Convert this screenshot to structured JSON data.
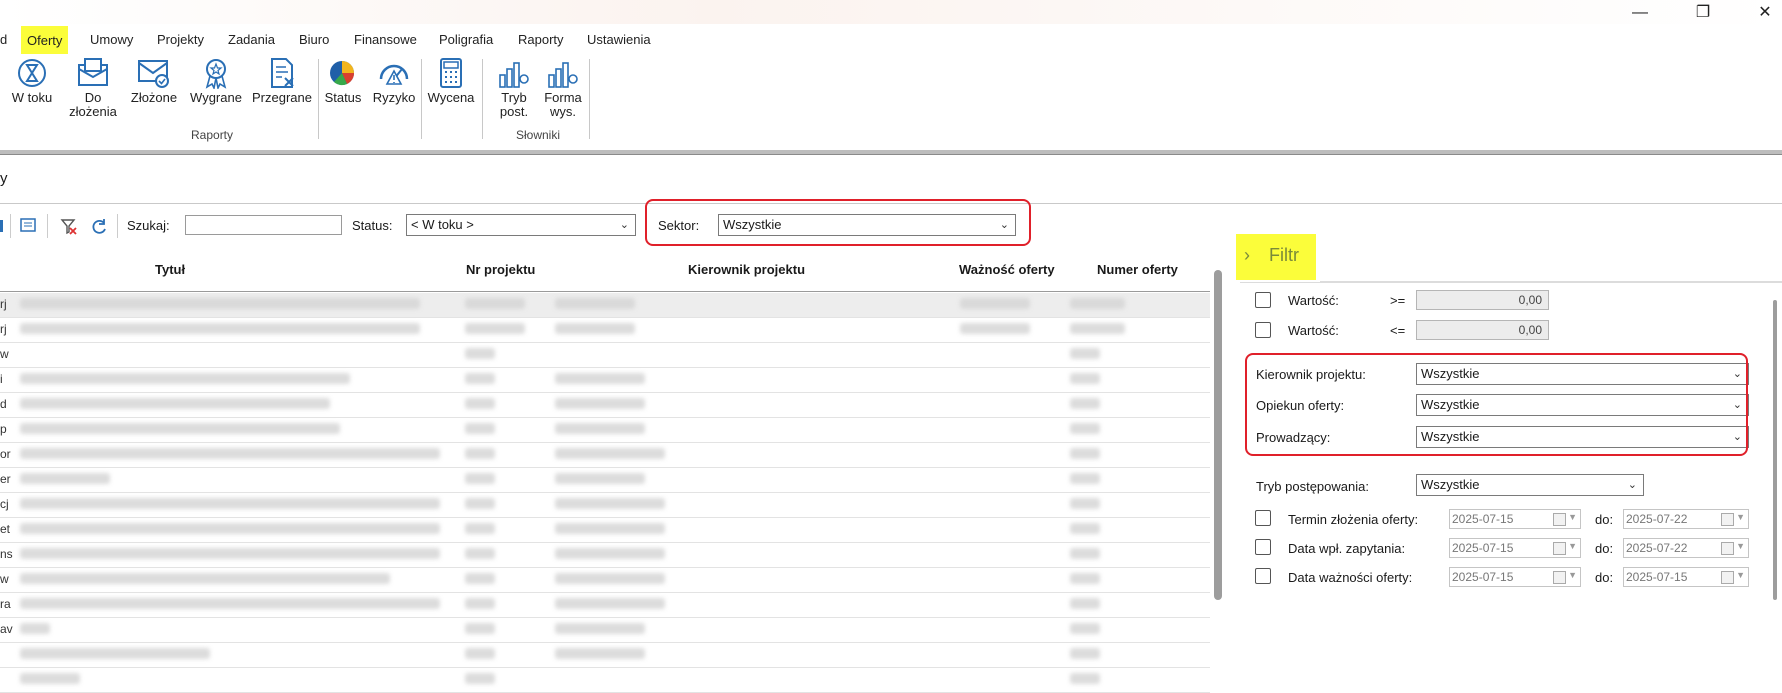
{
  "menu": {
    "items": [
      "d",
      "Oferty",
      "Umowy",
      "Projekty",
      "Zadania",
      "Biuro",
      "Finansowe",
      "Poligrafia",
      "Raporty",
      "Ustawienia"
    ],
    "active": "Oferty"
  },
  "window": {
    "minimize": "—",
    "maximize": "❐",
    "close": "✕"
  },
  "ribbon": {
    "buttons": {
      "w_toku": "W toku",
      "do_zlozenia_1": "Do",
      "do_zlozenia_2": "złożenia",
      "zlozone": "Złożone",
      "wygrane": "Wygrane",
      "przegrane": "Przegrane",
      "status": "Status",
      "ryzyko": "Ryzyko",
      "wycena": "Wycena",
      "tryb_1": "Tryb",
      "tryb_2": "post.",
      "forma_1": "Forma",
      "forma_2": "wys."
    },
    "groups": {
      "raporty": "Raporty",
      "slowniki": "Słowniki"
    }
  },
  "page": {
    "title": "y"
  },
  "toolbar": {
    "search_label": "Szukaj:",
    "search_value": "",
    "status_label": "Status:",
    "status_value": "< W toku >",
    "sektor_label": "Sektor:",
    "sektor_value": "Wszystkie"
  },
  "grid": {
    "columns": [
      "Tytuł",
      "Nr projektu",
      "Kierownik projektu",
      "Ważność oferty",
      "Numer oferty"
    ],
    "row_prefixes": [
      "rj",
      "rj",
      "w",
      "i",
      "d",
      "p",
      "or",
      "er",
      "cj",
      "et",
      "ns",
      "w",
      "ra",
      "av",
      "",
      ""
    ]
  },
  "filter": {
    "title": "Filtr",
    "wartosc_label": "Wartość:",
    "ge": ">=",
    "le": "<=",
    "wartosc_min": "0,00",
    "wartosc_max": "0,00",
    "kierownik_label": "Kierownik projektu:",
    "kierownik_value": "Wszystkie",
    "opiekun_label": "Opiekun oferty:",
    "opiekun_value": "Wszystkie",
    "prowadzacy_label": "Prowadzący:",
    "prowadzacy_value": "Wszystkie",
    "tryb_label": "Tryb postępowania:",
    "tryb_value": "Wszystkie",
    "termin_label": "Termin złożenia oferty:",
    "data_wpl_label": "Data wpł. zapytania:",
    "data_waznosci_label": "Data ważności oferty:",
    "do_label": "do:",
    "termin_from": "2025-07-15",
    "termin_to": "2025-07-22",
    "data_wpl_from": "2025-07-15",
    "data_wpl_to": "2025-07-22",
    "data_waz_from": "2025-07-15",
    "data_waz_to": "2025-07-15"
  },
  "colors": {
    "highlight": "#fbfd3a",
    "red_outline": "#e0202a",
    "icon_blue": "#2a6fb5"
  }
}
